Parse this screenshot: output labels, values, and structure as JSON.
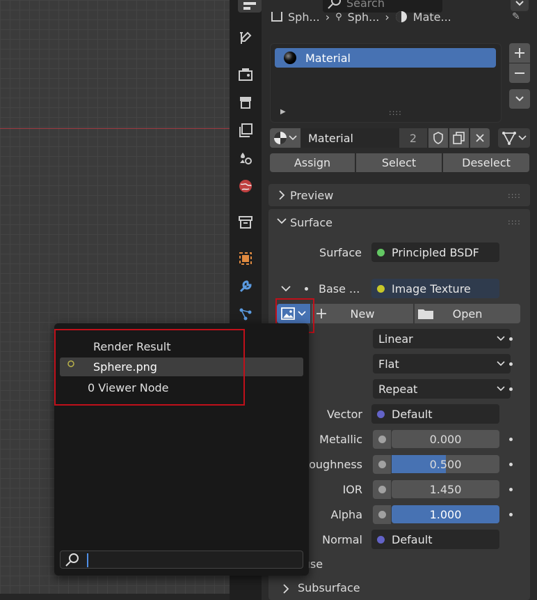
{
  "topbar": {
    "search_placeholder": "Search"
  },
  "breadcrumb": [
    "Sph...",
    "Sph...",
    "Mate..."
  ],
  "material_slots": [
    {
      "name": "Material"
    }
  ],
  "material_selector": {
    "name": "Material",
    "users": "2"
  },
  "slot_buttons": {
    "assign": "Assign",
    "select": "Select",
    "deselect": "Deselect"
  },
  "sections": {
    "preview": "Preview",
    "surface": "Surface",
    "diffuse": "Diffuse",
    "subsurface": "Subsurface"
  },
  "surface": {
    "label": "Surface",
    "shader": "Principled BSDF",
    "base_label": "Base ...",
    "base_value": "Image Texture"
  },
  "image_texture": {
    "new_label": "New",
    "open_label": "Open",
    "interpolation": "Linear",
    "projection": "Flat",
    "extension": "Repeat"
  },
  "inputs": [
    {
      "label": "Vector",
      "value": "Default",
      "kind": "vector"
    },
    {
      "label": "Metallic",
      "value": "0.000",
      "fill": 0.0
    },
    {
      "label": "Roughness",
      "value": "0.500",
      "fill": 0.5
    },
    {
      "label": "IOR",
      "value": "1.450",
      "fill": 0.0
    },
    {
      "label": "Alpha",
      "value": "1.000",
      "fill": 1.0
    },
    {
      "label": "Normal",
      "value": "Default",
      "kind": "vector"
    }
  ],
  "image_popup": {
    "items": [
      "Render Result",
      "Sphere.png",
      "0 Viewer Node"
    ],
    "highlighted": "Sphere.png",
    "search_value": ""
  },
  "colors": {
    "accent": "#4772b3",
    "shader_socket": "#63c763",
    "color_socket": "#c7c729",
    "vector_socket": "#6363c7",
    "highlight_box": "#c0101a"
  }
}
